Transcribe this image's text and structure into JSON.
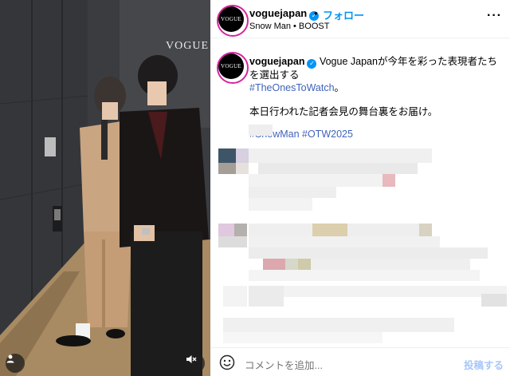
{
  "header": {
    "username": "voguejapan",
    "verified_icon": "verified-badge-icon",
    "separator": "•",
    "follow_label": "フォロー",
    "subtitle": "Snow Man • BOOST",
    "more_icon": "more-options-icon"
  },
  "avatar": {
    "logo_text": "VOGUE"
  },
  "media": {
    "watermark": "VOGUE",
    "left_button_icon": "user-tag-icon",
    "right_button_icon": "mute-icon"
  },
  "caption": {
    "username": "voguejapan",
    "text_1": "Vogue Japanが今年を彩った表現者たちを選出する",
    "hashtag_1": "#TheOnesToWatch",
    "text_1_end": "。",
    "text_2": "本日行われた記者会見の舞台裏をお届け。",
    "hashtags": "#SnowMan #OTW2025"
  },
  "comment_bar": {
    "emoji_icon": "emoji-icon",
    "placeholder": "コメントを追加...",
    "post_label": "投稿する"
  },
  "colors": {
    "accent_blue": "#0095f6",
    "hashtag_blue": "#4063b9",
    "post_disabled": "#a8c7fa"
  }
}
